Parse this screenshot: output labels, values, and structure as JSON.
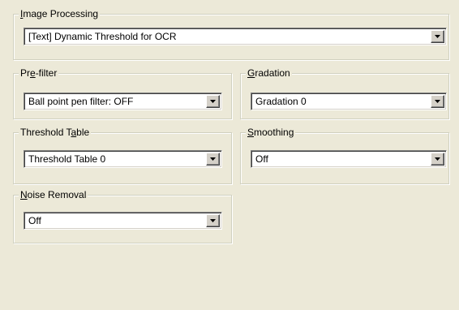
{
  "image_processing": {
    "label_pre": "",
    "label_key": "I",
    "label_post": "mage Processing",
    "value": "[Text] Dynamic Threshold for OCR"
  },
  "pre_filter": {
    "label_pre": "Pr",
    "label_key": "e",
    "label_post": "-filter",
    "value": "Ball point pen filter: OFF"
  },
  "gradation": {
    "label_pre": "",
    "label_key": "G",
    "label_post": "radation",
    "value": "Gradation 0"
  },
  "threshold_table": {
    "label_pre": "Threshold T",
    "label_key": "a",
    "label_post": "ble",
    "value": "Threshold Table 0"
  },
  "smoothing": {
    "label_pre": "",
    "label_key": "S",
    "label_post": "moothing",
    "value": "Off"
  },
  "noise_removal": {
    "label_pre": "",
    "label_key": "N",
    "label_post": "oise Removal",
    "value": "Off"
  },
  "icons": {
    "dropdown": "chevron-down-icon"
  }
}
